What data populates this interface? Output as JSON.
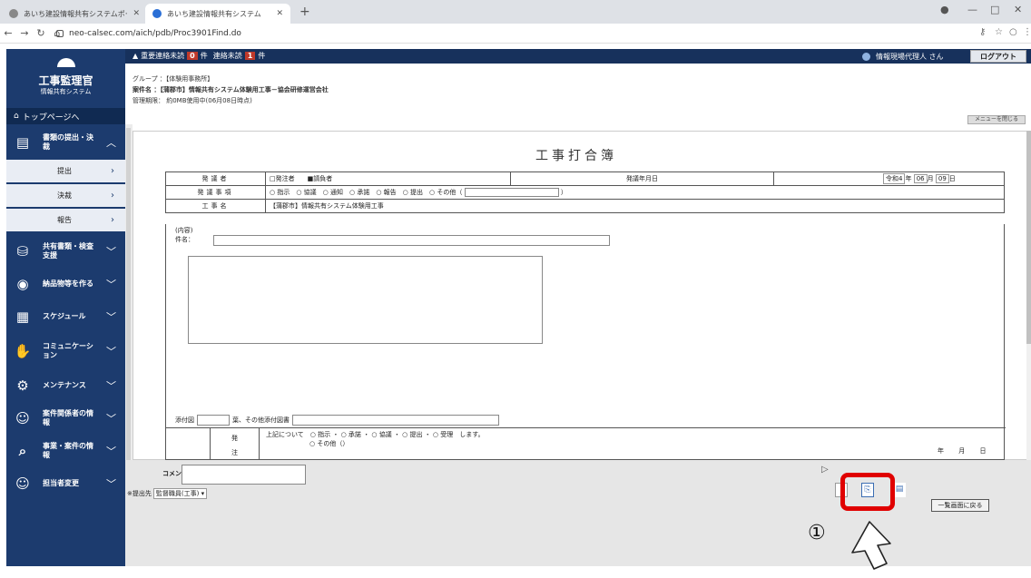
{
  "browser": {
    "tabs": [
      {
        "title": "あいち建設情報共有システムポータル",
        "active": false
      },
      {
        "title": "あいち建設情報共有システム",
        "active": true
      }
    ],
    "url": "neo-calsec.com/aich/pdb/Proc3901Find.do"
  },
  "sidebar": {
    "brand_title": "工事監理官",
    "brand_subtitle": "情報共有システム",
    "top_link": "トップページへ",
    "menu": [
      {
        "label": "書類の提出・決裁",
        "icon": "document-icon",
        "expanded": true
      },
      {
        "label": "共有書類・検査支援",
        "icon": "folder-share-icon"
      },
      {
        "label": "納品物等を作る",
        "icon": "disc-icon"
      },
      {
        "label": "スケジュール",
        "icon": "calendar-icon"
      },
      {
        "label": "コミュニケーション",
        "icon": "handshake-icon"
      },
      {
        "label": "メンテナンス",
        "icon": "gear-icon"
      },
      {
        "label": "案件関係者の情報",
        "icon": "people-icon"
      },
      {
        "label": "事業・案件の情報",
        "icon": "search-doc-icon"
      },
      {
        "label": "担当者変更",
        "icon": "people-swap-icon"
      }
    ],
    "submenu": [
      "提出",
      "決裁",
      "報告"
    ]
  },
  "header": {
    "alert_text_1": "重要連絡未読",
    "alert_count_1": "0",
    "alert_unit_1": "件",
    "alert_text_2": "連絡未読",
    "alert_count_2": "1",
    "alert_unit_2": "件",
    "user": "情報現場代理人 さん",
    "logout": "ログアウト"
  },
  "info": {
    "group": "グループ ：【体験用事務所】",
    "project": "案件名 ：【蒲郡市】情報共有システム体験用工事－協会研修運営会社",
    "term": "管理期限： 約0MB使用中(06月08日時点)",
    "menu_close": "メニューを閉じる"
  },
  "form": {
    "title": "工事打合簿",
    "row1_label": "発議者",
    "row1_options": "□発注者　　■請負者",
    "row1_date_label": "発議年月日",
    "date_era": "令和4",
    "date_year_suffix": "年",
    "date_month": "06",
    "date_month_suffix": "月",
    "date_day": "09",
    "date_day_suffix": "日",
    "row2_label": "発議事項",
    "row2_options": "○ 指示　○ 協議　○ 通知　○ 承諾　○ 報告　○ 提出　○ その他（",
    "row2_close": "）",
    "row3_label": "工事名",
    "row3_value": "【蒲郡市】情報共有システム体験用工事",
    "content_label": "(内容)",
    "subject_label": "件名：",
    "attach_label": "添付図",
    "attach_mid": "葉、その他添付図書",
    "bottom_col1_a": "発",
    "bottom_col1_b": "注",
    "bottom_text": "上記について　○ 指示 ・ ○ 承諾 ・ ○ 協議 ・ ○ 提出 ・ ○ 受理　します。",
    "bottom_text2": "○ その他（）",
    "bottom_date": "年 月 日"
  },
  "footer": {
    "comment_label": "コメント",
    "sendto_label": "※提出先",
    "sendto_value": "監督職員(工事)",
    "back_button": "一覧画面に戻る",
    "annotation_number": "①"
  }
}
